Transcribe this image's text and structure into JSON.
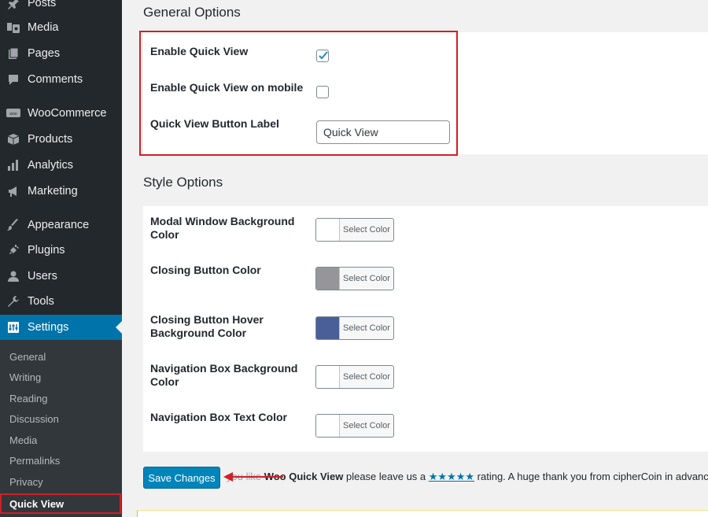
{
  "sidebar": {
    "items": [
      {
        "label": "Posts",
        "icon": "pin-icon"
      },
      {
        "label": "Media",
        "icon": "media-icon"
      },
      {
        "label": "Pages",
        "icon": "page-icon"
      },
      {
        "label": "Comments",
        "icon": "comment-icon"
      },
      {
        "label": "WooCommerce",
        "icon": "woo-icon"
      },
      {
        "label": "Products",
        "icon": "box-icon"
      },
      {
        "label": "Analytics",
        "icon": "bar-chart-icon"
      },
      {
        "label": "Marketing",
        "icon": "megaphone-icon"
      },
      {
        "label": "Appearance",
        "icon": "brush-icon"
      },
      {
        "label": "Plugins",
        "icon": "plug-icon"
      },
      {
        "label": "Users",
        "icon": "user-icon"
      },
      {
        "label": "Tools",
        "icon": "wrench-icon"
      },
      {
        "label": "Settings",
        "icon": "settings-icon"
      }
    ],
    "submenu": [
      "General",
      "Writing",
      "Reading",
      "Discussion",
      "Media",
      "Permalinks",
      "Privacy",
      "Quick View"
    ]
  },
  "general": {
    "title": "General Options",
    "enable_label": "Enable Quick View",
    "enable_checked": true,
    "mobile_label": "Enable Quick View on mobile",
    "mobile_checked": false,
    "button_label_label": "Quick View Button Label",
    "button_label_value": "Quick View"
  },
  "style": {
    "title": "Style Options",
    "select_color_label": "Select Color",
    "rows": [
      {
        "label": "Modal Window Background Color",
        "color": "#ffffff"
      },
      {
        "label": "Closing Button Color",
        "color": "#95959a"
      },
      {
        "label": "Closing Button Hover Background Color",
        "color": "#4a5f97"
      },
      {
        "label": "Navigation Box Background Color",
        "color": "#ffffff"
      },
      {
        "label": "Navigation Box Text Color",
        "color": "#ffffff"
      }
    ]
  },
  "footer": {
    "save_label": "Save Changes",
    "promo_faded": "you like ",
    "promo_product": "Woo Quick View",
    "promo_mid": " please leave us a ",
    "promo_stars": "★★★★★",
    "promo_end": " rating. A huge thank you from cipherCoin in advance!"
  },
  "colors": {
    "sidebar_bg": "#23282d",
    "active": "#0073aa",
    "highlight": "#d11f26"
  }
}
